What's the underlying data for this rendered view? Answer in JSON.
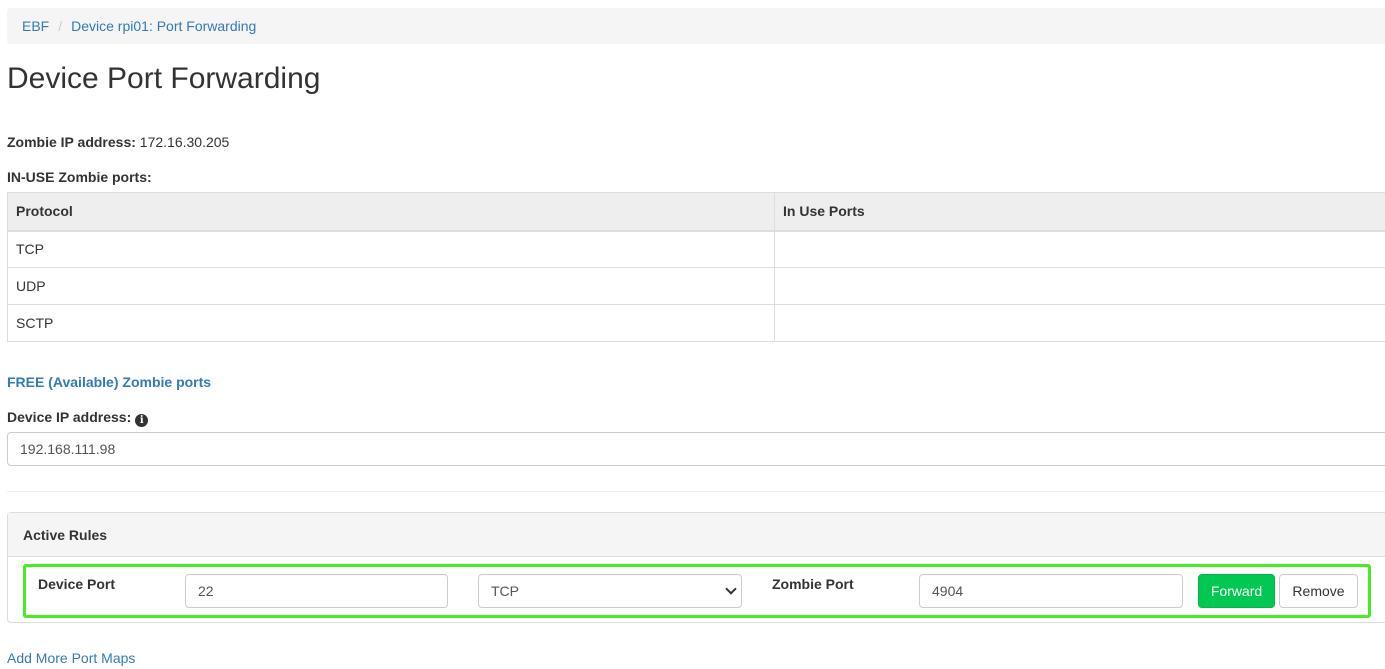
{
  "breadcrumb": {
    "items": [
      "EBF",
      "Device rpi01: Port Forwarding"
    ],
    "separator": "/"
  },
  "page_title": "Device Port Forwarding",
  "zombie_ip": {
    "label": "Zombie IP address:",
    "value": "172.16.30.205"
  },
  "in_use": {
    "label": "IN-USE Zombie ports:",
    "columns": [
      "Protocol",
      "In Use Ports"
    ],
    "rows": [
      {
        "protocol": "TCP",
        "ports": ""
      },
      {
        "protocol": "UDP",
        "ports": ""
      },
      {
        "protocol": "SCTP",
        "ports": ""
      }
    ]
  },
  "free_ports_link": "FREE (Available) Zombie ports",
  "device_ip": {
    "label": "Device IP address:",
    "value": "192.168.111.98",
    "info_icon": "info-circle-icon"
  },
  "active_rules": {
    "title": "Active Rules",
    "rule": {
      "device_port_label": "Device Port",
      "device_port_value": "22",
      "protocol_selected": "TCP",
      "zombie_port_label": "Zombie Port",
      "zombie_port_value": "4904",
      "forward_label": "Forward",
      "remove_label": "Remove"
    }
  },
  "add_more_link": "Add More Port Maps",
  "colors": {
    "link": "#337ab7",
    "forward_button": "#00c853",
    "highlight_border": "#44ee22"
  }
}
